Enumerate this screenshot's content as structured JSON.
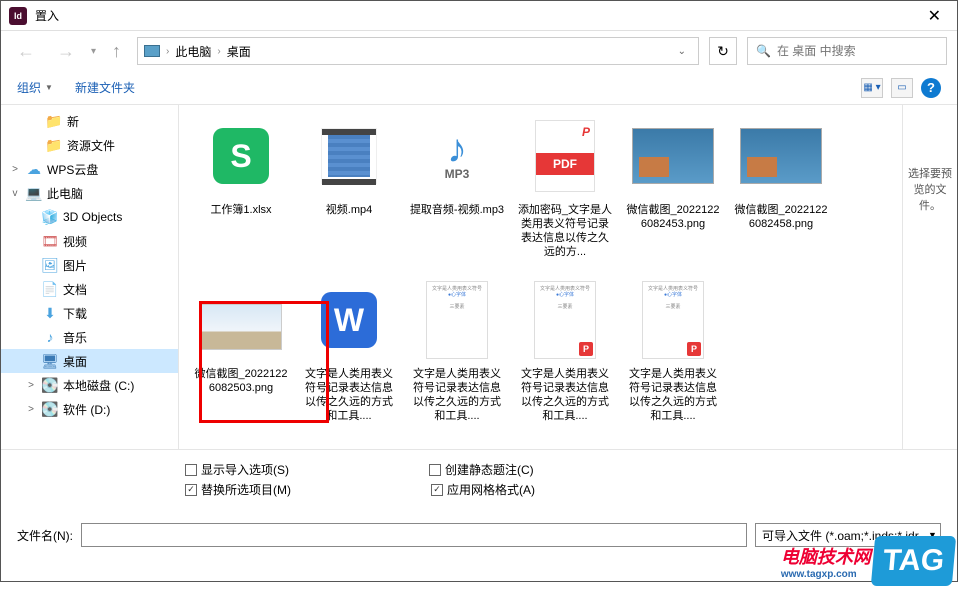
{
  "titlebar": {
    "app_icon_text": "Id",
    "title": "置入",
    "close": "✕"
  },
  "nav": {
    "path_root": "此电脑",
    "path_leaf": "桌面",
    "search_placeholder": "在 桌面 中搜索"
  },
  "toolbar": {
    "organize": "组织",
    "newfolder": "新建文件夹",
    "help": "?"
  },
  "sidebar": {
    "items": [
      {
        "label": "新",
        "icon": "folder",
        "indent": 2,
        "iconClass": "folder-icn"
      },
      {
        "label": "资源文件",
        "icon": "folder",
        "indent": 2,
        "iconClass": "folder-icn"
      },
      {
        "label": "WPS云盘",
        "icon": "cloud",
        "exp": ">",
        "indent": 0,
        "iconClass": "cloud-icn"
      },
      {
        "label": "此电脑",
        "icon": "pc",
        "exp": "v",
        "indent": 0,
        "iconClass": "pc-icn"
      },
      {
        "label": "3D Objects",
        "icon": "3d",
        "indent": 1,
        "iconClass": "obj3d-icn"
      },
      {
        "label": "视频",
        "icon": "video",
        "indent": 1,
        "iconClass": "video-icn"
      },
      {
        "label": "图片",
        "icon": "pic",
        "indent": 1,
        "iconClass": "pic-icn"
      },
      {
        "label": "文档",
        "icon": "doc",
        "indent": 1,
        "iconClass": "doc-icn"
      },
      {
        "label": "下载",
        "icon": "dl",
        "indent": 1,
        "iconClass": "dl-icn"
      },
      {
        "label": "音乐",
        "icon": "music",
        "indent": 1,
        "iconClass": "music-icn"
      },
      {
        "label": "桌面",
        "icon": "desk",
        "indent": 1,
        "iconClass": "desk-icn",
        "selected": true
      },
      {
        "label": "本地磁盘 (C:)",
        "icon": "drive",
        "exp": ">",
        "indent": 1,
        "iconClass": "drive-icn"
      },
      {
        "label": "软件 (D:)",
        "icon": "drive",
        "exp": ">",
        "indent": 1,
        "iconClass": "drive-icn"
      }
    ]
  },
  "files": [
    {
      "name": "工作簿1.xlsx",
      "type": "xlsx",
      "glyph": "S"
    },
    {
      "name": "视频.mp4",
      "type": "mp4"
    },
    {
      "name": "提取音频-视频.mp3",
      "type": "mp3",
      "glyph": "♪",
      "sub": "MP3"
    },
    {
      "name": "添加密码_文字是人类用表义符号记录表达信息以传之久远的方...",
      "type": "pdf",
      "glyph": "PDF"
    },
    {
      "name": "微信截图_20221226082453.png",
      "type": "bridge"
    },
    {
      "name": "微信截图_20221226082458.png",
      "type": "bridge"
    },
    {
      "name": "微信截图_20221226082503.png",
      "type": "sky",
      "highlighted": true
    },
    {
      "name": "文字是人类用表义符号记录表达信息以传之久远的方式和工具....",
      "type": "docx",
      "glyph": "W"
    },
    {
      "name": "文字是人类用表义符号记录表达信息以传之久远的方式和工具....",
      "type": "docpage"
    },
    {
      "name": "文字是人类用表义符号记录表达信息以传之久远的方式和工具....",
      "type": "docpage_p"
    },
    {
      "name": "文字是人类用表义符号记录表达信息以传之久远的方式和工具....",
      "type": "docpage_p"
    }
  ],
  "preview": {
    "text": "选择要预览的文件。"
  },
  "options": {
    "show_import": "显示导入选项(S)",
    "create_static": "创建静态题注(C)",
    "replace_selected": "替换所选项目(M)",
    "apply_grid": "应用网格格式(A)"
  },
  "filename": {
    "label": "文件名(N):",
    "value": "",
    "filter": "可导入文件 (*.oam;*.inds;*.idr..."
  },
  "watermark": {
    "brand": "电脑技术网",
    "url": "www.tagxp.com",
    "tag": "TAG"
  },
  "doc_lines": {
    "a": "文字是人类用表义符号",
    "b": "●心字体",
    "c": "三要素"
  }
}
